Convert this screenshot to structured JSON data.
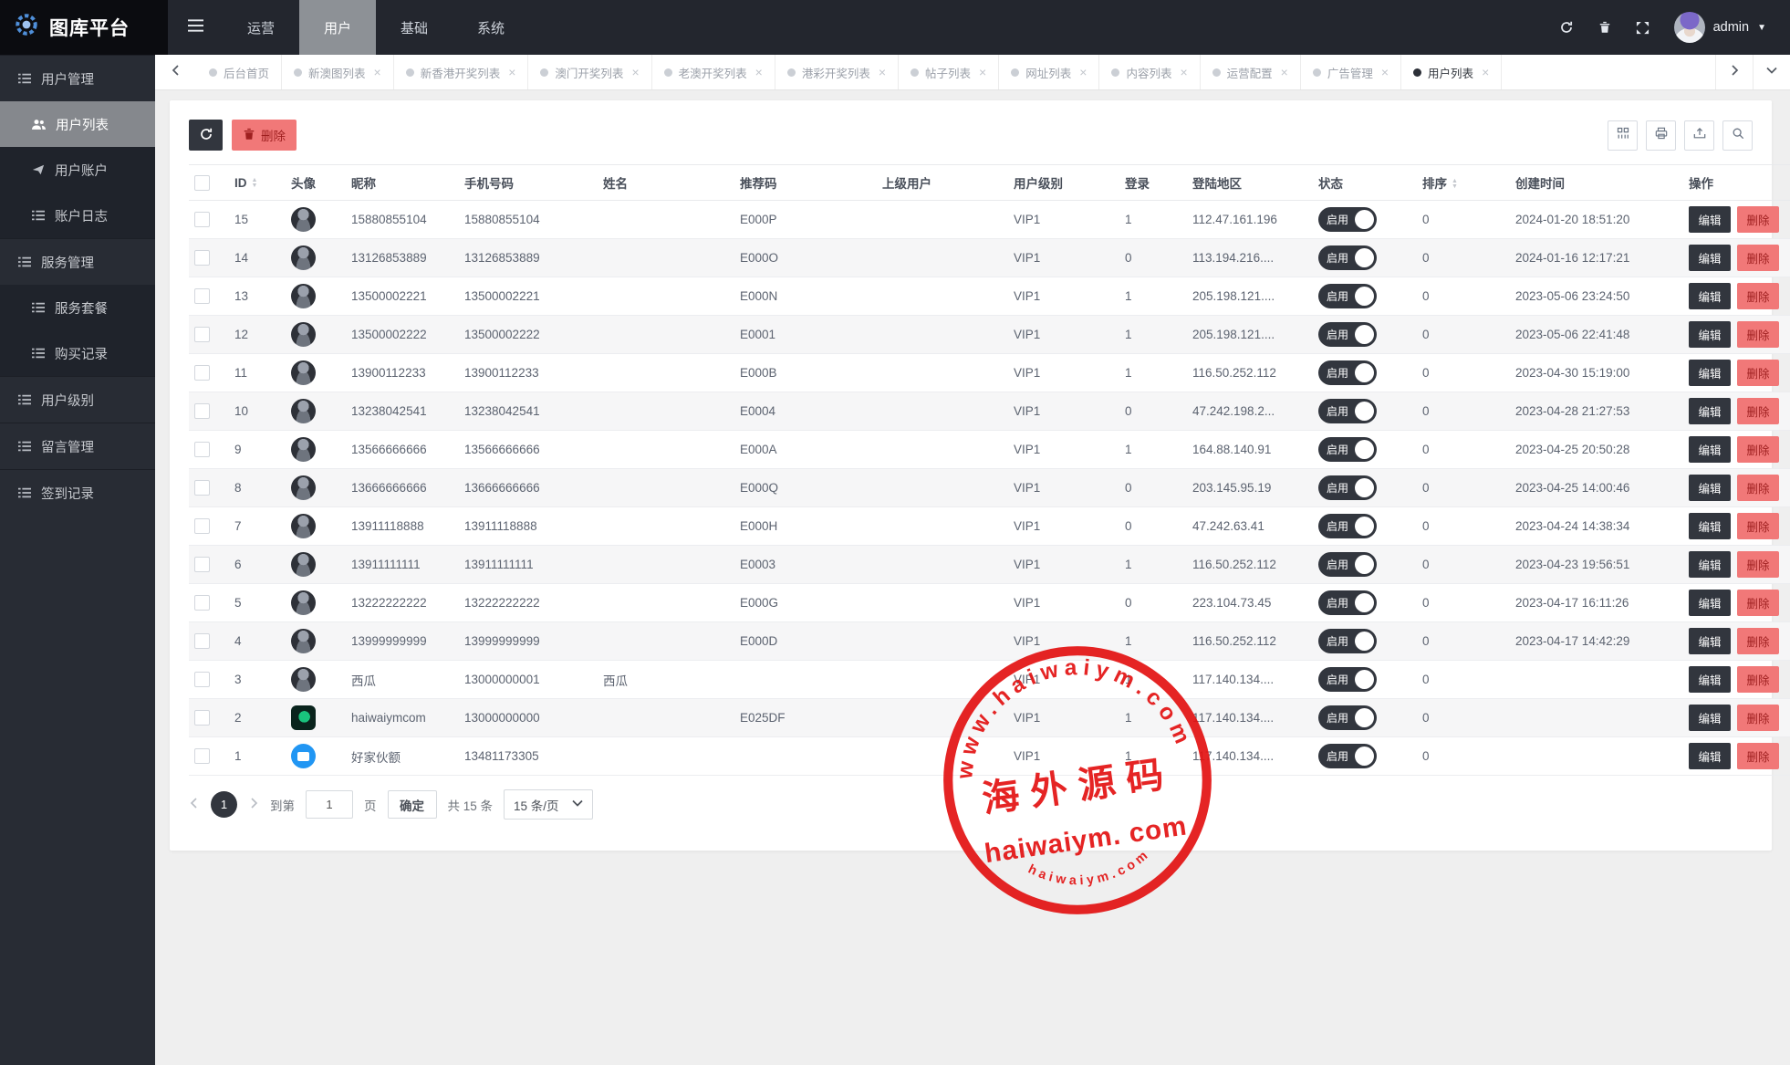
{
  "brand": {
    "title": "图库平台"
  },
  "topnav": {
    "items": [
      {
        "label": "运营",
        "active": false
      },
      {
        "label": "用户",
        "active": true
      },
      {
        "label": "基础",
        "active": false
      },
      {
        "label": "系统",
        "active": false
      }
    ],
    "username": "admin"
  },
  "tabs": {
    "items": [
      {
        "label": "后台首页",
        "closable": false,
        "active": false
      },
      {
        "label": "新澳图列表",
        "closable": true,
        "active": false
      },
      {
        "label": "新香港开奖列表",
        "closable": true,
        "active": false
      },
      {
        "label": "澳门开奖列表",
        "closable": true,
        "active": false
      },
      {
        "label": "老澳开奖列表",
        "closable": true,
        "active": false
      },
      {
        "label": "港彩开奖列表",
        "closable": true,
        "active": false
      },
      {
        "label": "帖子列表",
        "closable": true,
        "active": false
      },
      {
        "label": "网址列表",
        "closable": true,
        "active": false
      },
      {
        "label": "内容列表",
        "closable": true,
        "active": false
      },
      {
        "label": "运营配置",
        "closable": true,
        "active": false
      },
      {
        "label": "广告管理",
        "closable": true,
        "active": false
      },
      {
        "label": "用户列表",
        "closable": true,
        "active": true
      }
    ]
  },
  "sidebar": {
    "items": [
      {
        "label": "用户管理",
        "icon": "list",
        "level": 0,
        "active": false
      },
      {
        "label": "用户列表",
        "icon": "users",
        "level": 1,
        "active": true
      },
      {
        "label": "用户账户",
        "icon": "send",
        "level": 1,
        "active": false
      },
      {
        "label": "账户日志",
        "icon": "list",
        "level": 1,
        "active": false
      },
      {
        "label": "服务管理",
        "icon": "list",
        "level": 0,
        "active": false
      },
      {
        "label": "服务套餐",
        "icon": "list",
        "level": 1,
        "active": false
      },
      {
        "label": "购买记录",
        "icon": "list",
        "level": 1,
        "active": false
      },
      {
        "label": "用户级别",
        "icon": "list",
        "level": 0,
        "active": false
      },
      {
        "label": "留言管理",
        "icon": "list",
        "level": 0,
        "active": false
      },
      {
        "label": "签到记录",
        "icon": "list",
        "level": 0,
        "active": false
      }
    ]
  },
  "toolbar": {
    "delete_label": "删除"
  },
  "table": {
    "edit_label": "编辑",
    "delete_label": "删除",
    "columns": [
      {
        "key": "id",
        "label": "ID",
        "sortable": true
      },
      {
        "key": "avatar",
        "label": "头像"
      },
      {
        "key": "nickname",
        "label": "昵称"
      },
      {
        "key": "phone",
        "label": "手机号码"
      },
      {
        "key": "name",
        "label": "姓名"
      },
      {
        "key": "ref",
        "label": "推荐码"
      },
      {
        "key": "parent",
        "label": "上级用户"
      },
      {
        "key": "level",
        "label": "用户级别"
      },
      {
        "key": "login",
        "label": "登录"
      },
      {
        "key": "region",
        "label": "登陆地区"
      },
      {
        "key": "status",
        "label": "状态"
      },
      {
        "key": "sort",
        "label": "排序",
        "sortable": true
      },
      {
        "key": "created",
        "label": "创建时间"
      },
      {
        "key": "ops",
        "label": "操作"
      }
    ],
    "rows": [
      {
        "id": "15",
        "avatar": "anime",
        "nickname": "15880855104",
        "phone": "15880855104",
        "name": "",
        "ref": "E000P",
        "parent": "",
        "level": "VIP1",
        "login": "1",
        "region": "112.47.161.196",
        "status": "启用",
        "sort": "0",
        "created": "2024-01-20 18:51:20"
      },
      {
        "id": "14",
        "avatar": "anime",
        "nickname": "13126853889",
        "phone": "13126853889",
        "name": "",
        "ref": "E000O",
        "parent": "",
        "level": "VIP1",
        "login": "0",
        "region": "113.194.216....",
        "status": "启用",
        "sort": "0",
        "created": "2024-01-16 12:17:21"
      },
      {
        "id": "13",
        "avatar": "anime",
        "nickname": "13500002221",
        "phone": "13500002221",
        "name": "",
        "ref": "E000N",
        "parent": "",
        "level": "VIP1",
        "login": "1",
        "region": "205.198.121....",
        "status": "启用",
        "sort": "0",
        "created": "2023-05-06 23:24:50"
      },
      {
        "id": "12",
        "avatar": "anime",
        "nickname": "13500002222",
        "phone": "13500002222",
        "name": "",
        "ref": "E0001",
        "parent": "",
        "level": "VIP1",
        "login": "1",
        "region": "205.198.121....",
        "status": "启用",
        "sort": "0",
        "created": "2023-05-06 22:41:48"
      },
      {
        "id": "11",
        "avatar": "anime",
        "nickname": "13900112233",
        "phone": "13900112233",
        "name": "",
        "ref": "E000B",
        "parent": "",
        "level": "VIP1",
        "login": "1",
        "region": "116.50.252.112",
        "status": "启用",
        "sort": "0",
        "created": "2023-04-30 15:19:00"
      },
      {
        "id": "10",
        "avatar": "anime",
        "nickname": "13238042541",
        "phone": "13238042541",
        "name": "",
        "ref": "E0004",
        "parent": "",
        "level": "VIP1",
        "login": "0",
        "region": "47.242.198.2...",
        "status": "启用",
        "sort": "0",
        "created": "2023-04-28 21:27:53"
      },
      {
        "id": "9",
        "avatar": "anime",
        "nickname": "13566666666",
        "phone": "13566666666",
        "name": "",
        "ref": "E000A",
        "parent": "",
        "level": "VIP1",
        "login": "1",
        "region": "164.88.140.91",
        "status": "启用",
        "sort": "0",
        "created": "2023-04-25 20:50:28"
      },
      {
        "id": "8",
        "avatar": "anime",
        "nickname": "13666666666",
        "phone": "13666666666",
        "name": "",
        "ref": "E000Q",
        "parent": "",
        "level": "VIP1",
        "login": "0",
        "region": "203.145.95.19",
        "status": "启用",
        "sort": "0",
        "created": "2023-04-25 14:00:46"
      },
      {
        "id": "7",
        "avatar": "anime",
        "nickname": "13911118888",
        "phone": "13911118888",
        "name": "",
        "ref": "E000H",
        "parent": "",
        "level": "VIP1",
        "login": "0",
        "region": "47.242.63.41",
        "status": "启用",
        "sort": "0",
        "created": "2023-04-24 14:38:34"
      },
      {
        "id": "6",
        "avatar": "anime",
        "nickname": "13911111111",
        "phone": "13911111111",
        "name": "",
        "ref": "E0003",
        "parent": "",
        "level": "VIP1",
        "login": "1",
        "region": "116.50.252.112",
        "status": "启用",
        "sort": "0",
        "created": "2023-04-23 19:56:51"
      },
      {
        "id": "5",
        "avatar": "anime",
        "nickname": "13222222222",
        "phone": "13222222222",
        "name": "",
        "ref": "E000G",
        "parent": "",
        "level": "VIP1",
        "login": "0",
        "region": "223.104.73.45",
        "status": "启用",
        "sort": "0",
        "created": "2023-04-17 16:11:26"
      },
      {
        "id": "4",
        "avatar": "anime",
        "nickname": "13999999999",
        "phone": "13999999999",
        "name": "",
        "ref": "E000D",
        "parent": "",
        "level": "VIP1",
        "login": "1",
        "region": "116.50.252.112",
        "status": "启用",
        "sort": "0",
        "created": "2023-04-17 14:42:29"
      },
      {
        "id": "3",
        "avatar": "anime",
        "nickname": "西瓜",
        "phone": "13000000001",
        "name": "西瓜",
        "ref": "",
        "parent": "",
        "level": "VIP1",
        "login": "1",
        "region": "117.140.134....",
        "status": "启用",
        "sort": "0",
        "created": ""
      },
      {
        "id": "2",
        "avatar": "app",
        "nickname": "haiwaiymcom",
        "phone": "13000000000",
        "name": "",
        "ref": "E025DF",
        "parent": "",
        "level": "VIP1",
        "login": "1",
        "region": "117.140.134....",
        "status": "启用",
        "sort": "0",
        "created": ""
      },
      {
        "id": "1",
        "avatar": "photo",
        "nickname": "好家伙额",
        "phone": "13481173305",
        "name": "",
        "ref": "",
        "parent": "",
        "level": "VIP1",
        "login": "1",
        "region": "117.140.134....",
        "status": "启用",
        "sort": "0",
        "created": ""
      }
    ]
  },
  "pagination": {
    "current": "1",
    "goto_label": "到第",
    "page_value": "1",
    "page_unit": "页",
    "confirm_label": "确定",
    "total_label": "共 15 条",
    "per_page": "15 条/页"
  },
  "watermark": {
    "ring_text": "www.haiwaiym.com",
    "center_text": "海外源码",
    "brand_text": "haiwaiym. com",
    "bottom_text": "haiwaiym.com",
    "color": "#e31212"
  },
  "colors": {
    "topbar": "#23262e",
    "sidebar": "#282c34",
    "active_gray": "#8d9196",
    "dark_button": "#32363e",
    "danger_button": "#f17878",
    "stamp_red": "#e31212",
    "page_bg": "#efefef"
  }
}
